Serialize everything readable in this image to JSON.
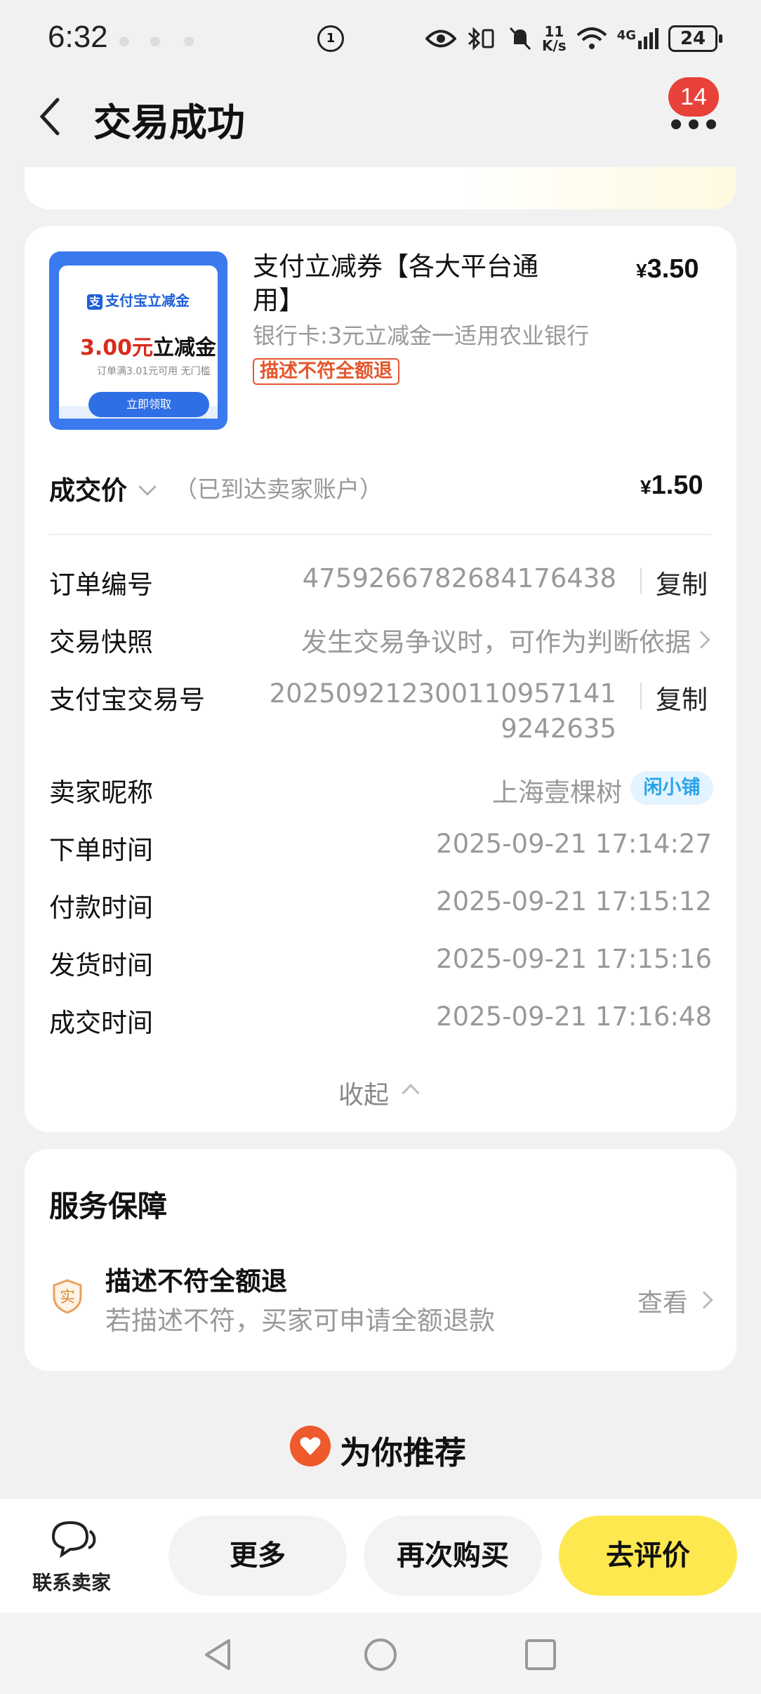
{
  "status_bar": {
    "time": "6:32",
    "network_speed_value": "11",
    "network_speed_unit": "K/s",
    "network_type": "4G",
    "battery": "24"
  },
  "header": {
    "title": "交易成功",
    "notification_count": "14",
    "back_icon": "chevron-left-icon",
    "more_icon": "more-dots-icon"
  },
  "order": {
    "thumbnail": {
      "brand": "支付宝立减金",
      "amount": "3.00元",
      "amount_suffix": "立减金",
      "subtext": "订单满3.01元可用 无门槛",
      "button": "立即领取"
    },
    "item_title": "支付立减券【各大平台通用】",
    "item_price_symbol": "¥",
    "item_price": "3.50",
    "item_sku": "银行卡:3元立减金一适用农业银行",
    "item_tag": "描述不符全额退",
    "deal_label": "成交价",
    "deal_note": "（已到达卖家账户）",
    "deal_price_symbol": "¥",
    "deal_price": "1.50",
    "details": {
      "order_no_label": "订单编号",
      "order_no_value": "4759266782684176438",
      "copy_label": "复制",
      "snapshot_label": "交易快照",
      "snapshot_value": "发生交易争议时，可作为判断依据",
      "alipay_no_label": "支付宝交易号",
      "alipay_no_line1": "2025092123001109571 41",
      "alipay_no_line1_display": "202509212300110957141",
      "alipay_no_line2": "9242635",
      "seller_label": "卖家昵称",
      "seller_value": "上海壹棵树",
      "seller_badge": "闲小铺",
      "order_time_label": "下单时间",
      "order_time_value": "2025-09-21 17:14:27",
      "pay_time_label": "付款时间",
      "pay_time_value": "2025-09-21 17:15:12",
      "ship_time_label": "发货时间",
      "ship_time_value": "2025-09-21 17:15:16",
      "deal_time_label": "成交时间",
      "deal_time_value": "2025-09-21 17:16:48"
    },
    "collapse_label": "收起"
  },
  "service": {
    "title": "服务保障",
    "icon_char": "实",
    "name": "描述不符全额退",
    "desc": "若描述不符，买家可申请全额退款",
    "view_label": "查看"
  },
  "recommend": {
    "title": "为你推荐"
  },
  "bottom_bar": {
    "contact_label": "联系卖家",
    "more_label": "更多",
    "rebuy_label": "再次购买",
    "review_label": "去评价"
  },
  "colors": {
    "accent_yellow": "#fde94f",
    "tag_orange": "#e4572e",
    "badge_red": "#e8413a",
    "alipay_blue": "#3a79ee"
  }
}
